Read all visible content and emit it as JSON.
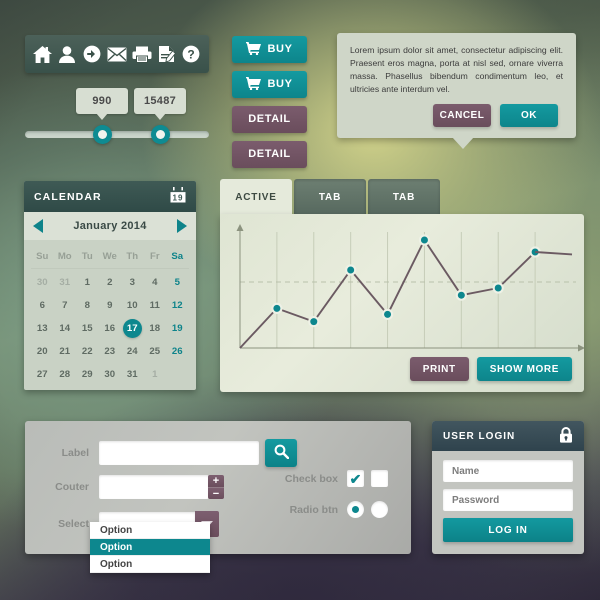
{
  "theme": {
    "teal": "#0d878e",
    "teal_light": "#149aa0",
    "plum": "#6f5263",
    "dark_green": "#3f5a55",
    "dark_blue": "#2f434d",
    "panel_gray": "#b9bcb8",
    "calendar_bg": "#c9d2c5"
  },
  "iconbar": {
    "icons": [
      {
        "name": "home-icon",
        "label": "Home"
      },
      {
        "name": "user-icon",
        "label": "User"
      },
      {
        "name": "arrow-right-circle-icon",
        "label": "Go"
      },
      {
        "name": "envelope-icon",
        "label": "Mail"
      },
      {
        "name": "printer-icon",
        "label": "Print"
      },
      {
        "name": "document-edit-icon",
        "label": "Edit document"
      },
      {
        "name": "question-circle-icon",
        "label": "Help"
      }
    ]
  },
  "sliders": [
    {
      "name": "slider-one",
      "value": "990",
      "percent": 42
    },
    {
      "name": "slider-two",
      "value": "15487",
      "percent": 75
    }
  ],
  "buttons": {
    "buy_1": "BUY",
    "buy_2": "BUY",
    "detail_1": "DETAIL",
    "detail_2": "DETAIL"
  },
  "tooltip": {
    "text": "Lorem ipsum dolor sit amet, consectetur adipiscing elit. Praesent eros magna, porta at nisl sed, ornare viverra massa. Phasellus bibendum condimentum leo, et ultricies ante interdum vel.",
    "cancel_label": "CANCEL",
    "ok_label": "OK"
  },
  "calendar": {
    "title": "CALENDAR",
    "icon": "calendar-icon",
    "icon_day": "19",
    "month_label": "January 2014",
    "prev_label": "Previous month",
    "next_label": "Next month",
    "dow": [
      "Su",
      "Mo",
      "Tu",
      "We",
      "Th",
      "Fr",
      "Sa"
    ],
    "weeks": [
      [
        {
          "d": "30",
          "muted": true
        },
        {
          "d": "31",
          "muted": true
        },
        {
          "d": "1"
        },
        {
          "d": "2"
        },
        {
          "d": "3"
        },
        {
          "d": "4"
        },
        {
          "d": "5",
          "sat": true
        }
      ],
      [
        {
          "d": "6"
        },
        {
          "d": "7"
        },
        {
          "d": "8"
        },
        {
          "d": "9"
        },
        {
          "d": "10"
        },
        {
          "d": "11"
        },
        {
          "d": "12",
          "sat": true
        }
      ],
      [
        {
          "d": "13"
        },
        {
          "d": "14"
        },
        {
          "d": "15"
        },
        {
          "d": "16"
        },
        {
          "d": "17",
          "today": true
        },
        {
          "d": "18"
        },
        {
          "d": "19",
          "sat": true
        }
      ],
      [
        {
          "d": "20"
        },
        {
          "d": "21"
        },
        {
          "d": "22"
        },
        {
          "d": "23"
        },
        {
          "d": "24"
        },
        {
          "d": "25"
        },
        {
          "d": "26",
          "sat": true
        }
      ],
      [
        {
          "d": "27"
        },
        {
          "d": "28"
        },
        {
          "d": "29"
        },
        {
          "d": "30"
        },
        {
          "d": "31"
        },
        {
          "d": "1",
          "muted": true
        },
        {
          "d": "",
          "muted": true
        }
      ]
    ]
  },
  "tabs": [
    {
      "label": "ACTIVE",
      "active": true
    },
    {
      "label": "TAB",
      "active": false
    },
    {
      "label": "TAB",
      "active": false
    }
  ],
  "chart_actions": {
    "print_label": "PRINT",
    "show_more_label": "SHOW MORE"
  },
  "chart_data": {
    "type": "line",
    "title": "",
    "xlabel": "",
    "ylabel": "",
    "grid": true,
    "gridlines_vertical": [
      0,
      1,
      2,
      3,
      4,
      5,
      6,
      7,
      8
    ],
    "gridline_horizontal_dashed_y": 55,
    "legend": "none",
    "xlim": [
      0,
      9
    ],
    "ylim": [
      0,
      100
    ],
    "x": [
      0,
      1,
      2,
      3,
      4,
      5,
      6,
      7,
      8,
      9
    ],
    "values": [
      0,
      33,
      22,
      65,
      28,
      90,
      44,
      50,
      80
    ],
    "marker_count": 8,
    "line_color": "#6b5a62",
    "marker_fill": "#0d878e",
    "marker_ring": "#eef1e6"
  },
  "form": {
    "label_field": {
      "label": "Label",
      "value": "",
      "placeholder": ""
    },
    "counter_field": {
      "label": "Couter",
      "value": "",
      "placeholder": "",
      "plus": "+",
      "minus": "−"
    },
    "select_field": {
      "label": "Select",
      "value": "",
      "placeholder": ""
    },
    "search_icon": "search-icon",
    "options": [
      {
        "text": "Option",
        "selected": false
      },
      {
        "text": "Option",
        "selected": true
      },
      {
        "text": "Option",
        "selected": false
      }
    ],
    "checkbox": {
      "label": "Check box",
      "checked_mark": "✔"
    },
    "radio": {
      "label": "Radio btn"
    }
  },
  "login": {
    "title": "USER LOGIN",
    "lock_icon": "lock-icon",
    "name_placeholder": "Name",
    "password_placeholder": "Password",
    "submit_label": "LOG IN"
  }
}
